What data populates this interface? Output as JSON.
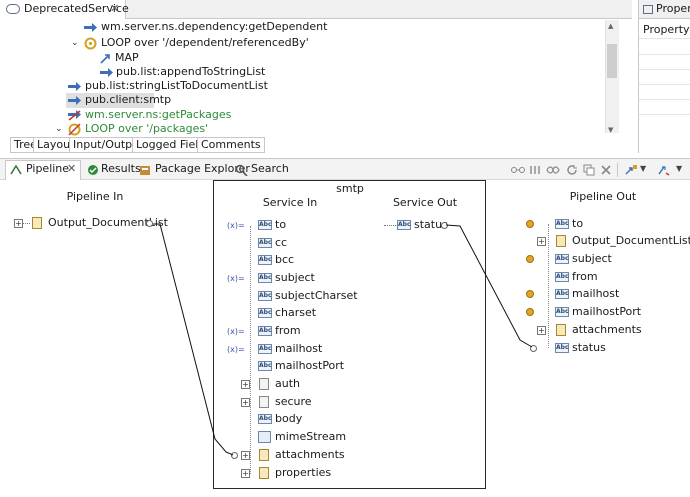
{
  "editor": {
    "tab_title": "DeprecatedService",
    "tree": [
      {
        "label": "wm.server.ns.dependency:getDependent",
        "icon": "invoke-arrow-icon",
        "color": "#1a1a1a"
      },
      {
        "label": "LOOP over '/dependent/referencedBy'",
        "icon": "loop-icon",
        "color": "#1a1a1a"
      },
      {
        "label": "MAP",
        "icon": "map-icon",
        "color": "#1a1a1a"
      },
      {
        "label": "pub.list:appendToStringList",
        "icon": "invoke-arrow-icon",
        "color": "#1a1a1a"
      },
      {
        "label": "pub.list:stringListToDocumentList",
        "icon": "invoke-arrow-icon",
        "color": "#1a1a1a"
      },
      {
        "label": "pub.client:smtp",
        "icon": "invoke-arrow-icon",
        "color": "#1a1a1a"
      },
      {
        "label": "wm.server.ns:getPackages",
        "icon": "invoke-disabled-icon",
        "color": "#2f8a3a"
      },
      {
        "label": "LOOP over '/packages'",
        "icon": "loop-disabled-icon",
        "color": "#2f8a3a"
      }
    ],
    "subtabs": [
      "Tree",
      "Layout",
      "Input/Output",
      "Logged Fields",
      "Comments"
    ]
  },
  "properties": {
    "tab_title": "Properti",
    "header": "Property"
  },
  "pipeline_view": {
    "tabs": [
      "Pipeline",
      "Results",
      "Package Explorer",
      "Search"
    ],
    "pipeline_in_title": "Pipeline In",
    "pipeline_out_title": "Pipeline Out",
    "service_title": "smtp",
    "service_in_title": "Service In",
    "service_out_title": "Service Out",
    "pipeline_in_items": [
      "Output_DocumentList"
    ],
    "service_in_items": [
      "to",
      "cc",
      "bcc",
      "subject",
      "subjectCharset",
      "charset",
      "from",
      "mailhost",
      "mailhostPort",
      "auth",
      "secure",
      "body",
      "mimeStream",
      "attachments",
      "properties"
    ],
    "service_out_items": [
      "status"
    ],
    "pipeline_out_items": [
      "to",
      "Output_DocumentList",
      "subject",
      "from",
      "mailhost",
      "mailhostPort",
      "attachments",
      "status"
    ]
  }
}
